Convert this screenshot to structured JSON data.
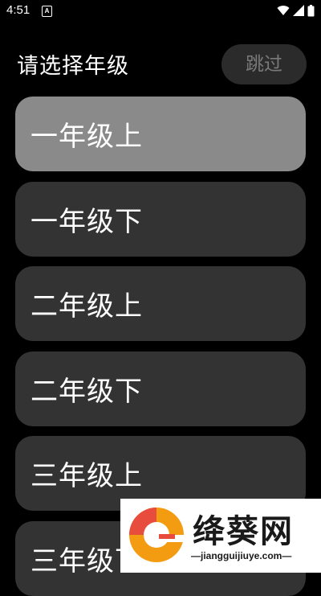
{
  "status_bar": {
    "time": "4:51",
    "notification_icon": "a-icon",
    "icons": [
      "wifi-icon",
      "signal-icon",
      "battery-icon"
    ]
  },
  "header": {
    "title": "请选择年级",
    "skip_label": "跳过"
  },
  "grades": [
    {
      "label": "一年级上",
      "selected": true
    },
    {
      "label": "一年级下",
      "selected": false
    },
    {
      "label": "二年级上",
      "selected": false
    },
    {
      "label": "二年级下",
      "selected": false
    },
    {
      "label": "三年级上",
      "selected": false
    },
    {
      "label": "三年级下",
      "selected": false
    }
  ],
  "colors": {
    "background": "#000000",
    "item": "#333333",
    "item_selected": "#8a8a8a",
    "skip_bg": "#2b2b2b",
    "skip_text": "#7a7a7a"
  },
  "watermark": {
    "name": "绛葵网",
    "url": "—jiangguijiuye.com—"
  }
}
